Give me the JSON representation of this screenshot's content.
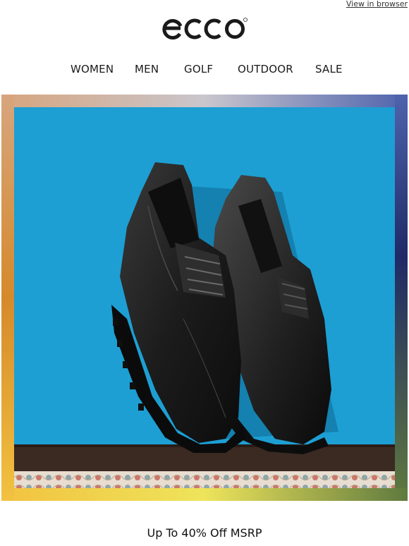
{
  "header": {
    "view_in_browser": "View in browser",
    "brand": "ecco"
  },
  "nav": {
    "items": [
      {
        "label": "WOMEN"
      },
      {
        "label": "MEN"
      },
      {
        "label": "GOLF"
      },
      {
        "label": "OUTDOOR"
      },
      {
        "label": "SALE"
      }
    ]
  },
  "hero": {
    "image": "black-leather-derby-shoes",
    "background": "#1ea9dd",
    "frame_colors": [
      "#d6a988",
      "#c7c1c7",
      "#5a6fb0",
      "#24306b",
      "#6b7d3a",
      "#e9e04a",
      "#f0b84a",
      "#d98c2c"
    ]
  },
  "promo": {
    "text": "Up To 40% Off MSRP"
  }
}
